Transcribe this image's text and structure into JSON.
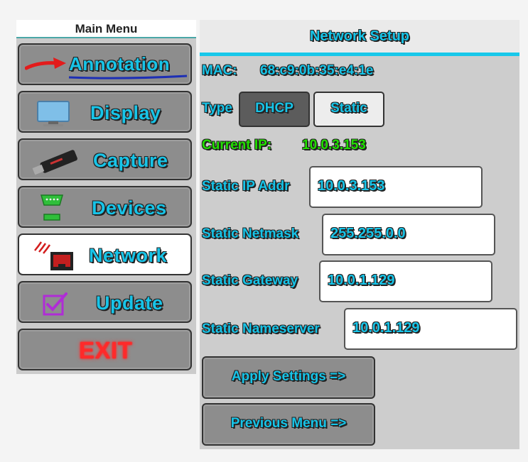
{
  "sidebar": {
    "title": "Main Menu",
    "items": [
      {
        "label": "Annotation",
        "icon": "red-arrow-icon"
      },
      {
        "label": "Display",
        "icon": "monitor-icon"
      },
      {
        "label": "Capture",
        "icon": "usb-dongle-icon"
      },
      {
        "label": "Devices",
        "icon": "serial-port-icon"
      },
      {
        "label": "Network",
        "icon": "network-port-icon",
        "active": true
      },
      {
        "label": "Update",
        "icon": "checkbox-icon"
      },
      {
        "label": "EXIT",
        "icon": "none"
      }
    ]
  },
  "panel": {
    "title": "Network Setup",
    "mac_label": "MAC:",
    "mac_value": "68:c9:0b:35:e4:1e",
    "type_label": "Type",
    "type_options": [
      "DHCP",
      "Static"
    ],
    "type_selected": "DHCP",
    "current_ip_label": "Current IP:",
    "current_ip_value": "10.0.3.153",
    "fields": [
      {
        "label": "Static IP Addr",
        "value": "10.0.3.153"
      },
      {
        "label": "Static Netmask",
        "value": "255.255.0.0"
      },
      {
        "label": "Static Gateway",
        "value": "10.0.1.129"
      },
      {
        "label": "Static Nameserver",
        "value": "10.0.1.129"
      }
    ],
    "apply_label": "Apply Settings =>",
    "previous_label": "Previous Menu =>"
  },
  "colors": {
    "accent": "#17c4e8",
    "ip_green": "#22e000",
    "exit_red": "#ff2a2a"
  }
}
